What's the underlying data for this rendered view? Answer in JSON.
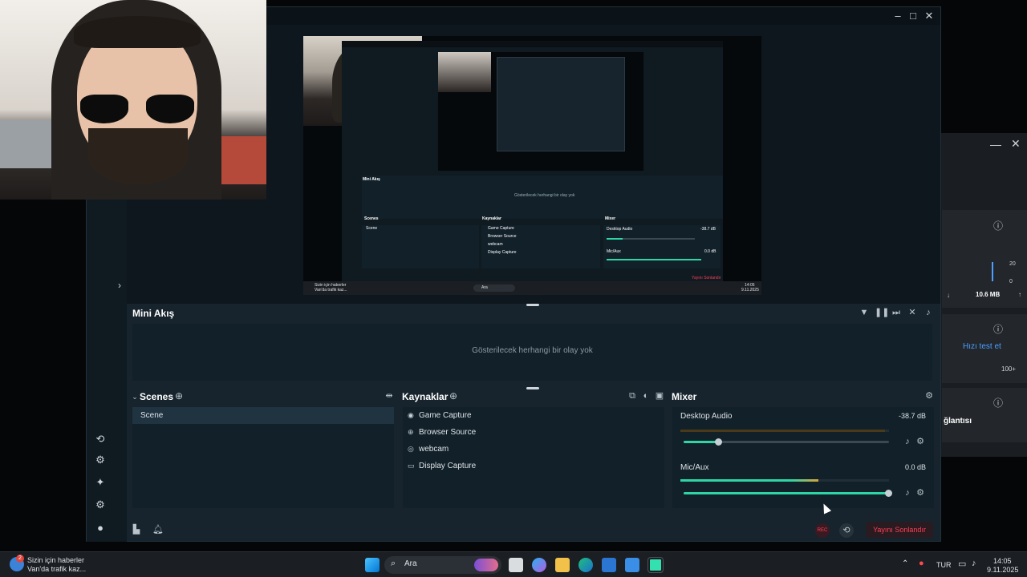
{
  "colors": {
    "accent_green": "#2fd6a5",
    "end_stream_red": "#ff3f55",
    "link_blue": "#4c9fff",
    "window_bg": "#17242d"
  },
  "app": {
    "window_buttons": [
      "–",
      "□",
      "✕"
    ]
  },
  "mini_feed": {
    "title": "Mini Akış",
    "empty_text": "Gösterilecek herhangi bir olay yok"
  },
  "scenes": {
    "title": "Scenes",
    "items": [
      "Scene"
    ]
  },
  "sources": {
    "title": "Kaynaklar",
    "items": [
      {
        "label": "Game Capture",
        "icon": "gamepad-icon"
      },
      {
        "label": "Browser Source",
        "icon": "globe-icon"
      },
      {
        "label": "webcam",
        "icon": "webcam-icon"
      },
      {
        "label": "Display Capture",
        "icon": "monitor-icon"
      }
    ]
  },
  "mixer": {
    "title": "Mixer",
    "channels": [
      {
        "name": "Desktop Audio",
        "db": "-38.7 dB",
        "level": 0.98,
        "volume": 0.17
      },
      {
        "name": "Mic/Aux",
        "db": "0.0 dB",
        "level": 0.66,
        "volume": 1.0
      }
    ]
  },
  "footer": {
    "end_stream_label": "Yayını Sonlandır"
  },
  "bg_window": {
    "speed_value": "10.6 MB",
    "speed_arrow": "↓",
    "speed_up": "↑",
    "test_link": "Hızı test et",
    "hundred_plus": "100+",
    "connection_label": "ğlantısı",
    "graph_top": "20",
    "graph_bottom": "0"
  },
  "nested": {
    "mini_feed_title": "Mini Akış",
    "empty_text": "Gösterilecek herhangi bir olay yok",
    "scenes_title": "Scenes",
    "scene_item": "Scene",
    "sources_title": "Kaynaklar",
    "sources": [
      "Game Capture",
      "Browser Source",
      "webcam",
      "Display Capture"
    ],
    "mixer_title": "Mixer",
    "desktop_audio": "Desktop Audio",
    "desktop_db": "-38.7 dB",
    "mic": "Mic/Aux",
    "mic_db": "0.0 dB",
    "end_stream": "Yayını Sonlandır",
    "news_line1": "Sizin için haberler",
    "news_line2": "Van'da trafik kaz...",
    "search_text": "Ara",
    "time": "14:05",
    "date": "9.11.2025"
  },
  "taskbar": {
    "news_title": "Sizin için haberler",
    "news_subtitle": "Van'da trafik kaz...",
    "news_badge": "2",
    "search_placeholder": "Ara",
    "language": "TUR",
    "time": "14:05",
    "date": "9.11.2025"
  }
}
